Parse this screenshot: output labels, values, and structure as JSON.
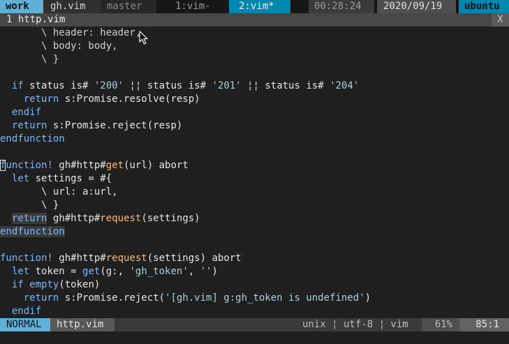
{
  "tmux": {
    "session": "work",
    "file": "gh.vim",
    "branch": "master",
    "windows": [
      "1:vim-",
      "2:vim*"
    ],
    "time": "00:28:24",
    "date": "2020/09/19",
    "host": "ubuntu"
  },
  "tabline": {
    "tab": "1 http.vim",
    "close": "X"
  },
  "editor": {
    "lines": [
      "       \\ header: header,",
      "       \\ body: body,",
      "       \\ }",
      "",
      "  if status is# '200' ¦¦ status is# '201' ¦¦ status is# '204'",
      "    return s:Promise.resolve(resp)",
      "  endif",
      "  return s:Promise.reject(resp)",
      "endfunction",
      "",
      "function! gh#http#get(url) abort",
      "  let settings = #{",
      "       \\ url: a:url,",
      "       \\ }",
      "  return gh#http#request(settings)",
      "endfunction",
      "",
      "function! gh#http#request(settings) abort",
      "  let token = get(g:, 'gh_token', '')",
      "  if empty(token)",
      "    return s:Promise.reject('[gh.vim] g:gh_token is undefined')",
      "  endif"
    ]
  },
  "statusline": {
    "mode": "NORMAL",
    "filename": "http.vim",
    "fileinfo": "unix ¦ utf-8 ¦ vim",
    "percent": "61%",
    "position": "85:1"
  },
  "colors": {
    "mode_bg": "#5fafd7",
    "tmux_active": "#0087af",
    "keyword": "#79b8ff",
    "function": "#ffb86c"
  }
}
